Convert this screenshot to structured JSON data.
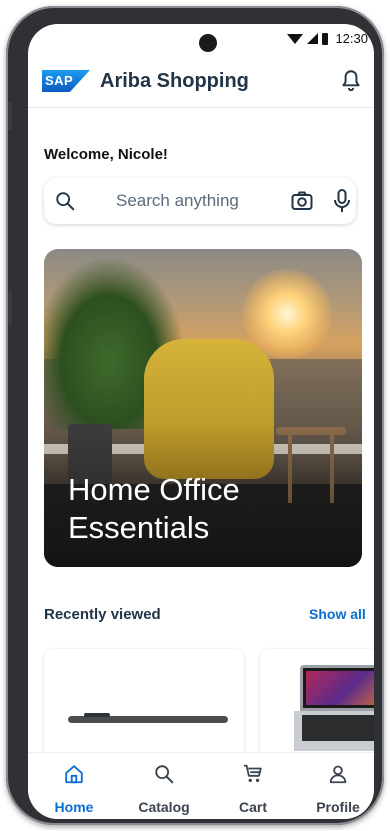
{
  "status_bar": {
    "time": "12:30",
    "icons": [
      "wifi-icon",
      "signal-icon",
      "battery-icon"
    ]
  },
  "header": {
    "logo_text": "SAP",
    "title": "Ariba Shopping",
    "notification_icon": "bell-icon"
  },
  "welcome": "Welcome, Nicole!",
  "search": {
    "placeholder": "Search anything",
    "icons": [
      "search-icon",
      "camera-icon",
      "microphone-icon"
    ]
  },
  "hero": {
    "title": "Home Office Essentials"
  },
  "recently_viewed": {
    "label": "Recently viewed",
    "show_all": "Show all",
    "items": [
      {
        "image": "pen"
      },
      {
        "image": "laptop"
      }
    ]
  },
  "tabs": [
    {
      "label": "Home",
      "icon": "home-icon",
      "active": true
    },
    {
      "label": "Catalog",
      "icon": "search-icon",
      "active": false
    },
    {
      "label": "Cart",
      "icon": "cart-icon",
      "active": false
    },
    {
      "label": "Profile",
      "icon": "person-icon",
      "active": false
    }
  ],
  "colors": {
    "accent": "#0a6ed1",
    "title": "#223548",
    "text": "#111111"
  }
}
